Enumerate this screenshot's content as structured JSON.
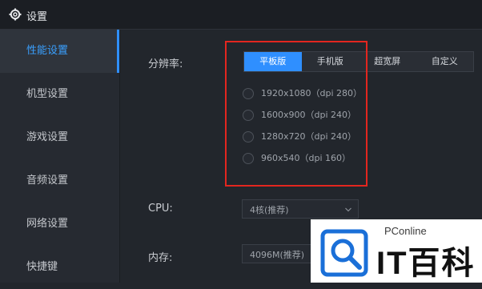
{
  "window": {
    "title": "设置",
    "title_icon": "gear-icon"
  },
  "sidebar": {
    "items": [
      {
        "label": "性能设置",
        "active": true
      },
      {
        "label": "机型设置",
        "active": false
      },
      {
        "label": "游戏设置",
        "active": false
      },
      {
        "label": "音频设置",
        "active": false
      },
      {
        "label": "网络设置",
        "active": false
      },
      {
        "label": "快捷键",
        "active": false
      }
    ]
  },
  "resolution": {
    "label": "分辨率:",
    "tabs": [
      {
        "label": "平板版",
        "active": true
      },
      {
        "label": "手机版",
        "active": false
      },
      {
        "label": "超宽屏",
        "active": false
      },
      {
        "label": "自定义",
        "active": false
      }
    ],
    "options": [
      "1920x1080（dpi 280）",
      "1600x900（dpi 240）",
      "1280x720（dpi 240）",
      "960x540（dpi 160）"
    ]
  },
  "cpu": {
    "label": "CPU:",
    "value": "4核(推荐)"
  },
  "memory": {
    "label": "内存:",
    "value": "4096M(推荐)"
  },
  "watermark": {
    "small": "PConline",
    "big": "IT百科"
  },
  "colors": {
    "accent": "#2f8fff",
    "highlight_box": "#e3261f",
    "background": "#22262c"
  }
}
